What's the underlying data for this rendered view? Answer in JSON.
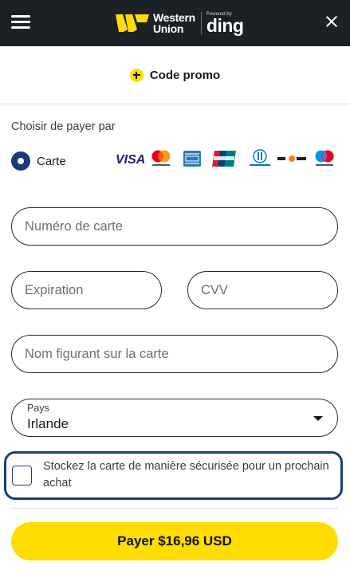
{
  "header": {
    "brand_line1": "Western",
    "brand_line2": "Union",
    "powered_by": "Powered by",
    "partner": "ding",
    "brand_color": "#ffdd00",
    "background": "#1c2126"
  },
  "promo": {
    "label": "Code promo"
  },
  "payment": {
    "title": "Choisir de payer par",
    "method_label": "Carte",
    "method_selected": true,
    "card_brands": [
      "visa-logo",
      "mastercard-logo",
      "amex-logo",
      "unionpay-logo",
      "diners-club-logo",
      "discover-logo",
      "maestro-logo"
    ]
  },
  "form": {
    "card_number_placeholder": "Numéro de carte",
    "expiry_placeholder": "Expiration",
    "cvv_placeholder": "CVV",
    "name_placeholder": "Nom figurant sur la carte",
    "country_caption": "Pays",
    "country_value": "Irlande",
    "store_card_label": "Stockez la carte de manière sécurisée pour un prochain achat",
    "store_card_checked": false
  },
  "actions": {
    "pay_label": "Payer $16,96 USD"
  },
  "colors": {
    "accent": "#ffdd00",
    "focus_border": "#1b3a7a",
    "radio": "#1b3a7a"
  }
}
